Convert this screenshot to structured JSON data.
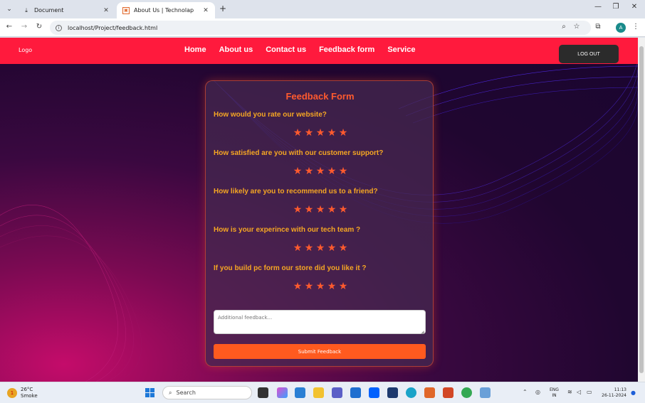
{
  "browser": {
    "tabs": [
      {
        "label": "Document",
        "active": false,
        "icon": "page-icon"
      },
      {
        "label": "About Us | Technolap",
        "active": true,
        "icon": "site-icon"
      }
    ],
    "url": "localhost/Project/feedback.html",
    "profile_initial": "A"
  },
  "site": {
    "logo": "Logo",
    "nav": [
      "Home",
      "About us",
      "Contact us",
      "Feedback form",
      "Service"
    ],
    "logout_label": "LOG OUT",
    "colors": {
      "navbar": "#ff1a3d",
      "accent": "#ff5a2e",
      "question": "#f5a623"
    }
  },
  "form": {
    "title": "Feedback Form",
    "questions": [
      {
        "text": "How would you rate our website?",
        "stars": 5
      },
      {
        "text": "How satisfied are you with our customer support?",
        "stars": 5
      },
      {
        "text": "How likely are you to recommend us to a friend?",
        "stars": 5
      },
      {
        "text": "How is your experince with our tech team ?",
        "stars": 5
      },
      {
        "text": "If you build pc form our store did you like it ?",
        "stars": 5
      }
    ],
    "feedback_placeholder": "Additional feedback...",
    "submit_label": "Submit Feedback"
  },
  "taskbar": {
    "weather_temp": "26°C",
    "weather_desc": "Smoke",
    "weather_badge": "1",
    "search_label": "Search",
    "lang_top": "ENG",
    "lang_bottom": "IN",
    "time": "11:13",
    "date": "26-11-2024"
  }
}
